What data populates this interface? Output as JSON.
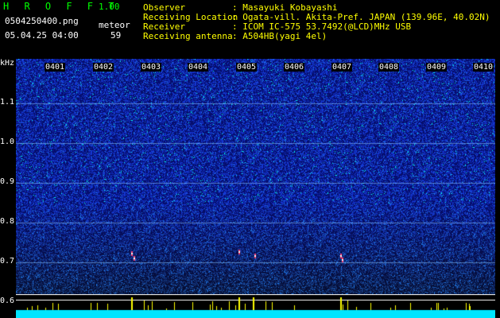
{
  "header": {
    "program_title": "H R O F F T",
    "version": "1.00",
    "filename": "0504250400.png",
    "timestamp": "05.04.25 04:00",
    "meteor_label": "meteor",
    "meteor_count": "59"
  },
  "station": {
    "observer_label": "Observer",
    "observer_value": ": Masayuki Kobayashi",
    "location_label": "Receiving Location",
    "location_value": ": Ogata-vill. Akita-Pref. JAPAN (139.96E, 40.02N)",
    "receiver_label": "Receiver",
    "receiver_value": ": ICOM IC-575 53.7492(@LCD)MHz USB",
    "antenna_label": "Receiving antenna",
    "antenna_value": ": A504HB(yagi 4el)"
  },
  "axis": {
    "y_unit": "kHz",
    "y_ticks": [
      "1.1",
      "1.0",
      "0.9",
      "0.8",
      "0.7",
      "0.6"
    ],
    "x_ticks": [
      "0401",
      "0402",
      "0403",
      "0404",
      "0405",
      "0406",
      "0407",
      "0408",
      "0409",
      "0410"
    ]
  },
  "colors": {
    "background": "#000000",
    "header_green": "#00ff00",
    "header_yellow": "#ffff00",
    "spectrum_blue": "#1830b0",
    "bottom_cyan": "#00e5ff"
  }
}
